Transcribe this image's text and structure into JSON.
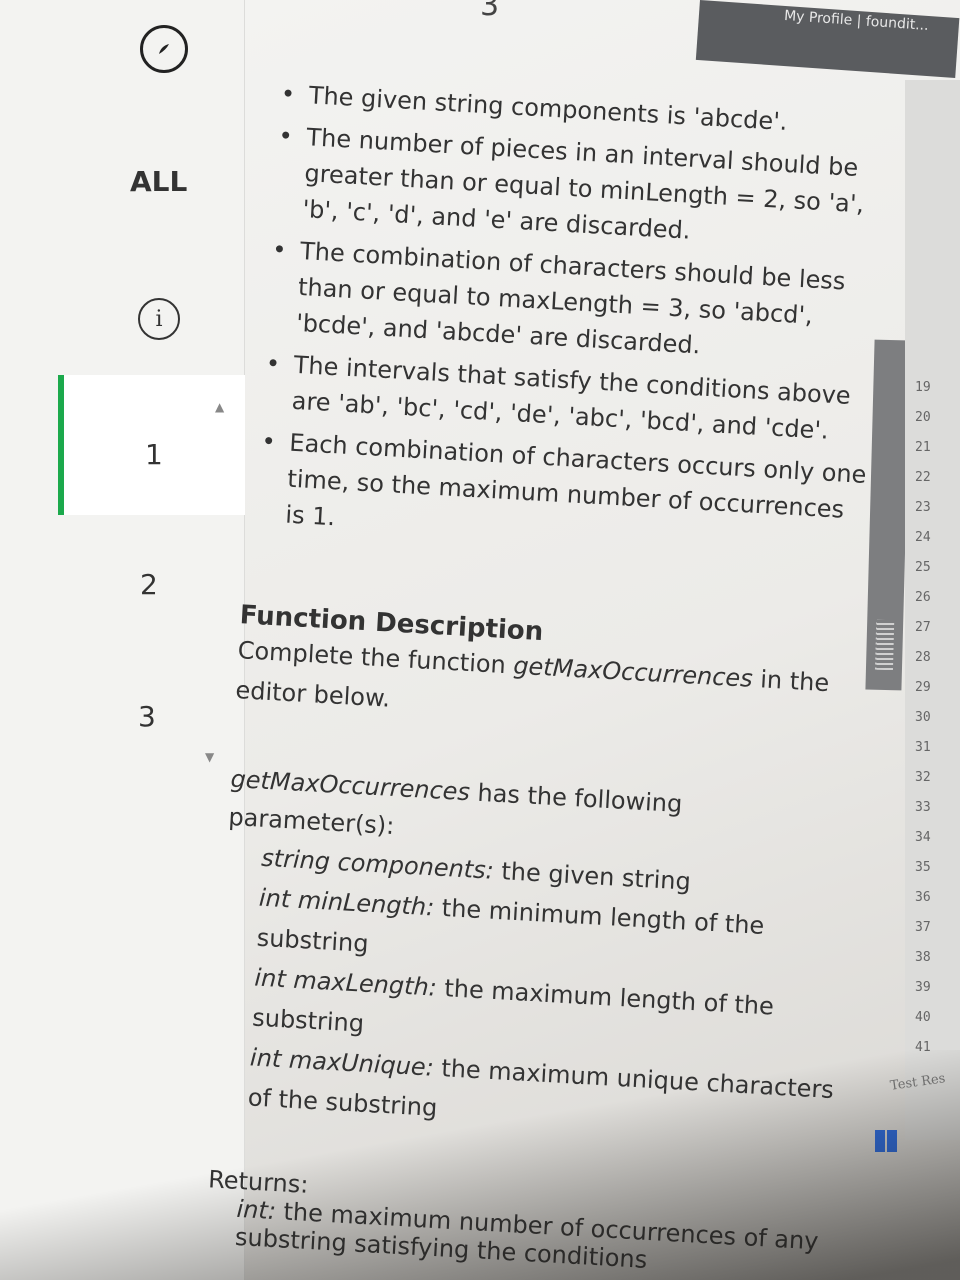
{
  "browser": {
    "tab_title": "My Profile | foundit..."
  },
  "sidebar": {
    "all_label": "ALL",
    "questions": [
      "1",
      "2",
      "3"
    ],
    "active_question": "1"
  },
  "problem": {
    "bullets": [
      "The given string components is 'abcde'.",
      "The number of pieces in an interval should be greater than or equal to minLength = 2, so 'a', 'b', 'c', 'd', and 'e' are discarded.",
      "The combination of characters should be less than or equal to maxLength = 3, so 'abcd', 'bcde', and 'abcde' are discarded.",
      "The intervals that satisfy the conditions above are 'ab', 'bc', 'cd', 'de', 'abc', 'bcd', and 'cde'.",
      "Each combination of characters occurs only one time, so the maximum number of occurrences is 1."
    ],
    "function_description_title": "Function Description",
    "function_description_pre": "Complete the function ",
    "function_name": "getMaxOccurrences",
    "function_description_post": " in the editor below.",
    "params_intro_fn": "getMaxOccurrences",
    "params_intro_text": " has the following parameter(s):",
    "params": [
      {
        "type_name": "string components:",
        "desc": "the given string"
      },
      {
        "type_name": "int minLength:",
        "desc": "the minimum length of the substring"
      },
      {
        "type_name": "int maxLength:",
        "desc": "the maximum length of the substring"
      },
      {
        "type_name": "int maxUnique:",
        "desc": "the maximum unique characters of the substring"
      }
    ],
    "returns_title": "Returns:",
    "returns_type": "int:",
    "returns_desc": "the maximum number of occurrences of any substring satisfying the conditions"
  },
  "editor": {
    "line_numbers": [
      "19",
      "20",
      "21",
      "22",
      "23",
      "24",
      "25",
      "26",
      "27",
      "28",
      "29",
      "30",
      "31",
      "32",
      "33",
      "34",
      "35",
      "36",
      "37",
      "38",
      "39",
      "40",
      "41"
    ]
  },
  "footer": {
    "test_results": "Test Res"
  },
  "colors": {
    "accent": "#1ba94c",
    "text": "#333333",
    "scrollbar": "#7d7e80"
  }
}
